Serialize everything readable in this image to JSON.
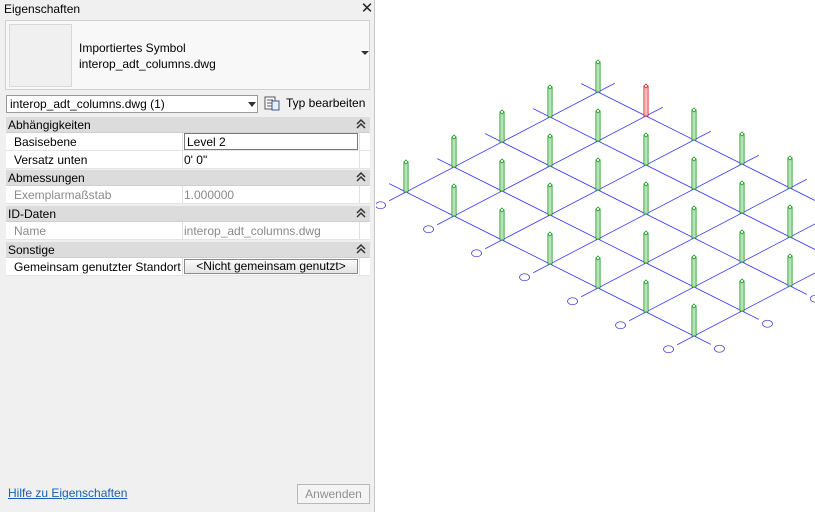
{
  "window": {
    "title": "Eigenschaften",
    "close_glyph": "✕"
  },
  "preview": {
    "line1": "Importiertes Symbol",
    "line2": "interop_adt_columns.dwg"
  },
  "selector": {
    "value": "interop_adt_columns.dwg (1)",
    "edit_type_label": "Typ bearbeiten",
    "edit_type_icon": "edit-type-icon"
  },
  "sections": [
    {
      "title": "Abhängigkeiten",
      "rows": [
        {
          "key": "Basisebene",
          "value": "Level 2"
        },
        {
          "key": "Versatz unten",
          "value": "0'  0\""
        }
      ]
    },
    {
      "title": "Abmessungen",
      "rows": [
        {
          "key": "Exemplarmaßstab",
          "value": "1.000000"
        }
      ]
    },
    {
      "title": "ID-Daten",
      "rows": [
        {
          "key": "Name",
          "value": "interop_adt_columns.dwg"
        }
      ]
    },
    {
      "title": "Sonstige",
      "rows": [
        {
          "key": "Gemeinsam genutzter Standort",
          "value": "<Nicht gemeinsam genutzt>"
        }
      ]
    }
  ],
  "footer": {
    "help_link": "Hilfe zu Eigenschaften",
    "apply_label": "Anwenden"
  },
  "colors": {
    "grid_line": "#3a3aff",
    "column": "#1a9a1a",
    "column_selected": "#e02020",
    "bubble": "#4a4adf"
  }
}
